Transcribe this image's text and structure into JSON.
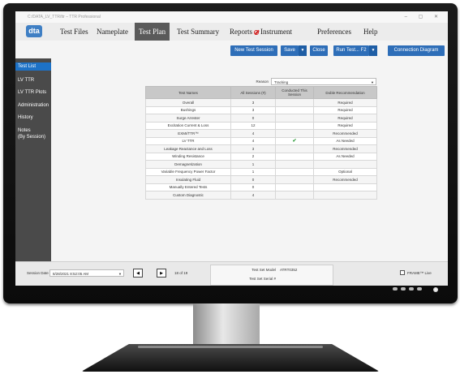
{
  "window": {
    "title": "C:/DATA_LV_TTR/ttr – TTR Professional",
    "controls": "–  ▢  ✕"
  },
  "menu": {
    "logo": "dta",
    "items": [
      "Test Files",
      "Nameplate",
      "Test Plan",
      "Test Summary",
      "Reports",
      "Instrument",
      "Preferences",
      "Help"
    ],
    "active": "Test Plan"
  },
  "toolbar": {
    "new_session": "New Test Session",
    "save": "Save",
    "close": "Close",
    "run_test": "Run Test...  F2",
    "connection_diagram": "Connection Diagram"
  },
  "sidebar": {
    "items": [
      "Test List",
      "LV TTR",
      "LV TTR Plots",
      "Administration",
      "History",
      "Notes\n(By Session)"
    ],
    "active": "Test List"
  },
  "plan": {
    "reason_label": "Reason",
    "reason_value": "Tracking",
    "headers": [
      "Test Names",
      "All Sessions (#)",
      "Conducted This Session",
      "Doble Recommendation"
    ],
    "rows": [
      {
        "name": "Overall",
        "count": "3",
        "conducted": "",
        "rec": "Required"
      },
      {
        "name": "Bushings",
        "count": "3",
        "conducted": "",
        "rec": "Required"
      },
      {
        "name": "Surge Arrester",
        "count": "0",
        "conducted": "",
        "rec": "Required"
      },
      {
        "name": "Excitation Current & Loss",
        "count": "12",
        "conducted": "",
        "rec": "Required"
      },
      {
        "name": "EXMI/TTR™",
        "count": "4",
        "conducted": "",
        "rec": "Recommended"
      },
      {
        "name": "LV TTR",
        "count": "4",
        "conducted": "✔",
        "rec": "As Needed"
      },
      {
        "name": "Leakage Reactance and Loss",
        "count": "3",
        "conducted": "",
        "rec": "Recommended"
      },
      {
        "name": "Winding Resistance",
        "count": "2",
        "conducted": "",
        "rec": "As Needed"
      },
      {
        "name": "Demagnetization",
        "count": "1",
        "conducted": "",
        "rec": ""
      },
      {
        "name": "Variable Frequency Power Factor",
        "count": "1",
        "conducted": "",
        "rec": "Optional"
      },
      {
        "name": "Insulating Fluid",
        "count": "0",
        "conducted": "",
        "rec": "Recommended"
      },
      {
        "name": "Manually Entered Tests",
        "count": "0",
        "conducted": "",
        "rec": ""
      },
      {
        "name": "Custom Diagnostic",
        "count": "4",
        "conducted": "",
        "rec": ""
      }
    ]
  },
  "status": {
    "session_date_label": "Session Date",
    "session_date_value": "8/28/2021 8:52:05 AM",
    "prev": "◀",
    "next": "▶",
    "page": "18 of 19",
    "model_label": "Test Set Model",
    "model_value": "ATRT0352",
    "serial_label": "Test Set Serial #",
    "serial_value": "",
    "frame_label": "FRAME™ Live"
  },
  "colors": {
    "accent": "#2e6eb8",
    "sidebar": "#4a4a4a",
    "active_sidebar": "#1d72c7",
    "check": "#2e9b3a"
  }
}
